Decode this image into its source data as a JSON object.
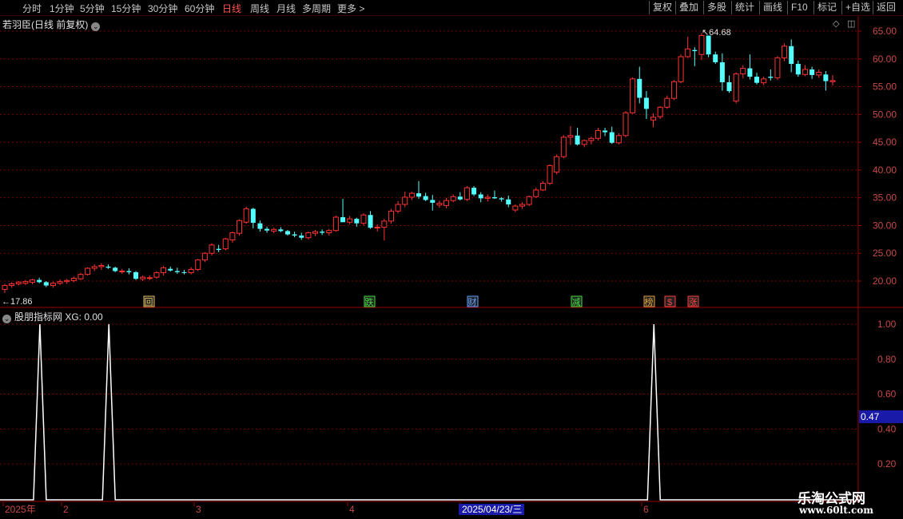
{
  "toolbar": {
    "periods": [
      "分时",
      "1分钟",
      "5分钟",
      "15分钟",
      "30分钟",
      "60分钟",
      "日线",
      "周线",
      "月线",
      "多周期",
      "更多 >"
    ],
    "active": "日线",
    "right": [
      "复权",
      "叠加",
      "多股",
      "统计",
      "画线",
      "F10",
      "标记",
      "+自选",
      "返回"
    ]
  },
  "main_title": "若羽臣(日线 前复权)",
  "indicator_title": "股朋指标网 XG: 0.00",
  "high_label": "64.68",
  "low_label": "17.86",
  "price_axis": [
    "65.00",
    "60.00",
    "55.00",
    "50.00",
    "45.00",
    "40.00",
    "35.00",
    "30.00",
    "25.00",
    "20.00"
  ],
  "ind_axis": [
    "1.00",
    "0.80",
    "0.60",
    "0.40",
    "0.20"
  ],
  "ind_marker": "0.47",
  "date_axis": [
    "2025年",
    "2",
    "3",
    "4",
    "2025/04/23/三",
    "6"
  ],
  "events": [
    {
      "text": "回",
      "color": "#e0c060"
    },
    {
      "text": "跌",
      "color": "#40e040"
    },
    {
      "text": "财",
      "color": "#60a0ff"
    },
    {
      "text": "减",
      "color": "#40e040"
    },
    {
      "text": "榜",
      "color": "#e0a040"
    },
    {
      "text": "$",
      "color": "#ff4040"
    },
    {
      "text": "涨",
      "color": "#ff4040"
    }
  ],
  "watermark": {
    "line1": "乐淘公式网",
    "line2": "www.60lt.com"
  },
  "colors": {
    "up": "#ff3232",
    "down": "#54ffff",
    "grid": "#7a0000",
    "bg": "#000000"
  },
  "chart_data": [
    {
      "type": "candlestick",
      "title": "若羽臣(日线 前复权)",
      "y_range": [
        16,
        67
      ],
      "annotations": {
        "high": 64.68,
        "low": 17.86
      },
      "ohlc": [
        [
          18.5,
          19.5,
          17.86,
          19.2
        ],
        [
          19.2,
          19.8,
          18.8,
          19.5
        ],
        [
          19.5,
          20.0,
          19.2,
          19.8
        ],
        [
          19.6,
          20.2,
          19.3,
          19.9
        ],
        [
          19.8,
          20.4,
          19.4,
          20.2
        ],
        [
          20.2,
          20.6,
          19.6,
          19.8
        ],
        [
          19.8,
          20.0,
          18.9,
          19.2
        ],
        [
          19.2,
          19.9,
          18.8,
          19.6
        ],
        [
          19.6,
          20.3,
          19.3,
          19.9
        ],
        [
          19.9,
          20.4,
          19.5,
          20.1
        ],
        [
          20.1,
          20.8,
          19.8,
          20.5
        ],
        [
          20.4,
          21.5,
          20.2,
          21.2
        ],
        [
          21.2,
          22.5,
          21.0,
          22.3
        ],
        [
          22.3,
          23.0,
          21.8,
          22.6
        ],
        [
          22.6,
          23.2,
          22.0,
          22.8
        ],
        [
          22.6,
          23.0,
          22.2,
          22.4
        ],
        [
          22.4,
          22.6,
          21.6,
          21.8
        ],
        [
          21.8,
          22.2,
          21.3,
          21.8
        ],
        [
          21.8,
          22.3,
          21.2,
          21.6
        ],
        [
          21.6,
          21.8,
          20.2,
          20.4
        ],
        [
          20.4,
          21.0,
          20.0,
          20.7
        ],
        [
          20.5,
          21.0,
          20.2,
          20.6
        ],
        [
          20.7,
          21.8,
          20.4,
          21.5
        ],
        [
          21.5,
          22.7,
          21.0,
          22.4
        ],
        [
          22.2,
          22.6,
          21.7,
          21.9
        ],
        [
          21.8,
          22.4,
          21.3,
          21.6
        ],
        [
          21.6,
          22.0,
          21.2,
          21.5
        ],
        [
          21.5,
          22.5,
          21.2,
          22.1
        ],
        [
          22.1,
          24.0,
          21.8,
          23.8
        ],
        [
          23.8,
          25.2,
          23.4,
          25.0
        ],
        [
          25.0,
          26.8,
          24.6,
          26.5
        ],
        [
          25.8,
          26.5,
          25.2,
          25.6
        ],
        [
          25.8,
          27.8,
          25.5,
          27.6
        ],
        [
          27.4,
          28.9,
          26.9,
          28.7
        ],
        [
          28.6,
          31.1,
          28.2,
          30.9
        ],
        [
          30.6,
          33.4,
          30.3,
          33.0
        ],
        [
          33.0,
          33.2,
          29.5,
          30.5
        ],
        [
          30.4,
          30.9,
          28.9,
          29.4
        ],
        [
          29.4,
          29.8,
          28.7,
          29.1
        ],
        [
          29.0,
          29.6,
          28.6,
          29.3
        ],
        [
          29.3,
          29.7,
          28.8,
          29.0
        ],
        [
          29.0,
          29.2,
          28.2,
          28.4
        ],
        [
          28.4,
          28.9,
          27.9,
          28.2
        ],
        [
          28.2,
          28.7,
          27.4,
          27.8
        ],
        [
          27.8,
          28.9,
          27.5,
          28.7
        ],
        [
          28.6,
          29.2,
          28.1,
          28.9
        ],
        [
          28.9,
          29.3,
          28.3,
          28.7
        ],
        [
          28.7,
          29.4,
          28.2,
          29.1
        ],
        [
          29.1,
          31.8,
          28.9,
          31.5
        ],
        [
          31.5,
          34.8,
          31.2,
          30.6
        ],
        [
          30.6,
          31.7,
          30.2,
          31.2
        ],
        [
          31.2,
          31.4,
          29.8,
          30.4
        ],
        [
          30.4,
          32.2,
          30.0,
          31.9
        ],
        [
          31.9,
          32.6,
          29.4,
          29.6
        ],
        [
          29.6,
          30.2,
          28.9,
          29.7
        ],
        [
          29.7,
          31.2,
          27.3,
          30.8
        ],
        [
          30.8,
          33.0,
          30.3,
          32.6
        ],
        [
          32.6,
          34.4,
          32.2,
          33.8
        ],
        [
          33.8,
          36.1,
          33.3,
          35.1
        ],
        [
          35.1,
          36.1,
          34.6,
          35.8
        ],
        [
          35.8,
          38.0,
          34.8,
          35.2
        ],
        [
          35.3,
          35.9,
          34.4,
          34.6
        ],
        [
          34.6,
          35.5,
          32.7,
          34.1
        ],
        [
          33.7,
          34.5,
          33.2,
          34.0
        ],
        [
          33.6,
          35.0,
          33.1,
          34.5
        ],
        [
          34.5,
          35.6,
          34.2,
          35.2
        ],
        [
          35.2,
          36.0,
          34.5,
          34.7
        ],
        [
          34.7,
          37.1,
          34.4,
          36.8
        ],
        [
          36.8,
          37.1,
          35.3,
          35.6
        ],
        [
          35.6,
          36.0,
          34.2,
          34.9
        ],
        [
          34.9,
          35.6,
          34.3,
          35.1
        ],
        [
          35.1,
          36.3,
          34.8,
          34.9
        ],
        [
          34.9,
          35.1,
          34.3,
          34.7
        ],
        [
          34.7,
          35.4,
          33.3,
          33.8
        ],
        [
          32.8,
          33.8,
          32.4,
          33.5
        ],
        [
          33.5,
          34.2,
          33.0,
          33.8
        ],
        [
          33.8,
          35.4,
          33.5,
          35.2
        ],
        [
          35.2,
          36.8,
          35.0,
          36.4
        ],
        [
          36.4,
          38.0,
          36.2,
          37.6
        ],
        [
          37.6,
          41.0,
          37.3,
          40.8
        ],
        [
          39.6,
          42.8,
          39.2,
          42.4
        ],
        [
          42.4,
          46.3,
          42.1,
          45.9
        ],
        [
          45.9,
          47.9,
          44.5,
          46.2
        ],
        [
          46.2,
          47.6,
          44.4,
          44.6
        ],
        [
          44.6,
          45.5,
          44.1,
          45.3
        ],
        [
          45.3,
          46.0,
          44.6,
          45.7
        ],
        [
          45.7,
          47.6,
          45.3,
          47.1
        ],
        [
          47.1,
          47.6,
          46.1,
          46.8
        ],
        [
          46.8,
          47.8,
          44.7,
          44.9
        ],
        [
          44.9,
          46.6,
          44.6,
          46.2
        ],
        [
          46.2,
          50.6,
          45.9,
          50.3
        ],
        [
          50.3,
          56.7,
          50.1,
          56.4
        ],
        [
          56.4,
          58.6,
          52.0,
          53.0
        ],
        [
          53.0,
          54.2,
          49.2,
          51.0
        ],
        [
          49.0,
          50.2,
          47.7,
          49.5
        ],
        [
          49.6,
          51.5,
          49.2,
          51.3
        ],
        [
          51.3,
          53.4,
          51.0,
          52.9
        ],
        [
          52.9,
          56.2,
          52.6,
          55.9
        ],
        [
          55.9,
          60.8,
          55.6,
          60.4
        ],
        [
          60.4,
          64.0,
          60.2,
          61.8
        ],
        [
          61.6,
          62.1,
          58.7,
          61.4
        ],
        [
          60.8,
          64.68,
          59.8,
          64.2
        ],
        [
          64.2,
          63.8,
          60.3,
          60.8
        ],
        [
          60.8,
          61.3,
          59.1,
          59.4
        ],
        [
          59.4,
          61.0,
          54.3,
          55.8
        ],
        [
          55.8,
          57.0,
          53.9,
          54.2
        ],
        [
          52.4,
          57.6,
          52.0,
          57.3
        ],
        [
          57.3,
          58.9,
          56.5,
          58.3
        ],
        [
          58.3,
          60.8,
          56.3,
          56.8
        ],
        [
          56.8,
          57.5,
          55.4,
          55.7
        ],
        [
          55.7,
          56.8,
          55.3,
          56.4
        ],
        [
          56.8,
          58.1,
          56.1,
          56.6
        ],
        [
          56.6,
          60.5,
          56.2,
          60.2
        ],
        [
          60.2,
          62.8,
          59.6,
          62.3
        ],
        [
          62.3,
          63.5,
          57.6,
          59.1
        ],
        [
          59.1,
          59.7,
          56.8,
          57.2
        ],
        [
          57.2,
          58.9,
          56.9,
          58.1
        ],
        [
          58.1,
          58.6,
          56.4,
          57.1
        ],
        [
          57.1,
          58.1,
          56.6,
          57.6
        ],
        [
          57.2,
          57.8,
          54.3,
          56.0
        ],
        [
          55.9,
          57.1,
          55.2,
          56.1
        ]
      ]
    },
    {
      "type": "line",
      "title": "股朋指标网 XG",
      "y_range": [
        0,
        1.1
      ],
      "spikes_at": [
        3,
        13,
        92
      ],
      "count": 122,
      "value_last": 0.0
    }
  ]
}
